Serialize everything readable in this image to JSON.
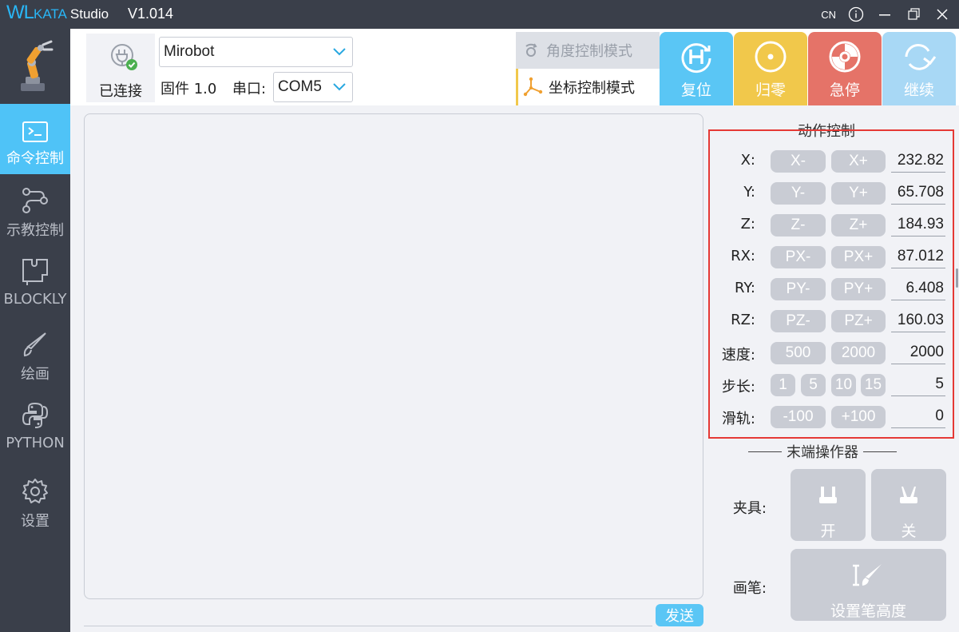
{
  "app": {
    "logo_main": "WL",
    "logo_sub": "KATA",
    "logo_tail": "Studio",
    "version": "V1.014",
    "lang": "CN",
    "colors": {
      "sidebar": "#3a3f4a",
      "accent": "#4fc3f7",
      "reset": "#5ac6f5",
      "home": "#f1c84b",
      "stop": "#e57368",
      "continue": "#a8d8f5",
      "pill": "#c9ccd4",
      "highlight": "#e53935"
    }
  },
  "sidebar": {
    "items": [
      {
        "label": "命令控制",
        "icon": "terminal-icon"
      },
      {
        "label": "示教控制",
        "icon": "teach-path-icon"
      },
      {
        "label": "BLOCKLY",
        "icon": "puzzle-icon"
      },
      {
        "label": "绘画",
        "icon": "brush-icon"
      },
      {
        "label": "PYTHON",
        "icon": "python-icon"
      },
      {
        "label": "设置",
        "icon": "gear-icon"
      }
    ]
  },
  "toolbar": {
    "connected_label": "已连接",
    "robot_select": "Mirobot",
    "firmware_label": "固件 1.0",
    "port_label": "串口:",
    "port_select": "COM5",
    "modes": {
      "angle": "角度控制模式",
      "coord": "坐标控制模式"
    },
    "buttons": {
      "reset": "复位",
      "home": "归零",
      "stop": "急停",
      "continue": "继续"
    }
  },
  "console": {
    "send_label": "发送"
  },
  "motion": {
    "title": "动作控制",
    "rows": [
      {
        "label": "X:",
        "minus": "X-",
        "plus": "X+",
        "value": "232.82"
      },
      {
        "label": "Y:",
        "minus": "Y-",
        "plus": "Y+",
        "value": "65.708"
      },
      {
        "label": "Z:",
        "minus": "Z-",
        "plus": "Z+",
        "value": "184.93"
      },
      {
        "label": "RX:",
        "minus": "PX-",
        "plus": "PX+",
        "value": "87.012"
      },
      {
        "label": "RY:",
        "minus": "PY-",
        "plus": "PY+",
        "value": "6.408"
      },
      {
        "label": "RZ:",
        "minus": "PZ-",
        "plus": "PZ+",
        "value": "160.03"
      }
    ],
    "speed": {
      "label": "速度:",
      "opt1": "500",
      "opt2": "2000",
      "value": "2000"
    },
    "step": {
      "label": "步长:",
      "opts": [
        "1",
        "5",
        "10",
        "15"
      ],
      "value": "5"
    },
    "rail": {
      "label": "滑轨:",
      "minus": "-100",
      "plus": "+100",
      "value": "0"
    }
  },
  "effector": {
    "title": "末端操作器",
    "gripper_label": "夹具:",
    "open": "开",
    "close": "关",
    "pen_label": "画笔:",
    "pen_height": "设置笔高度"
  }
}
